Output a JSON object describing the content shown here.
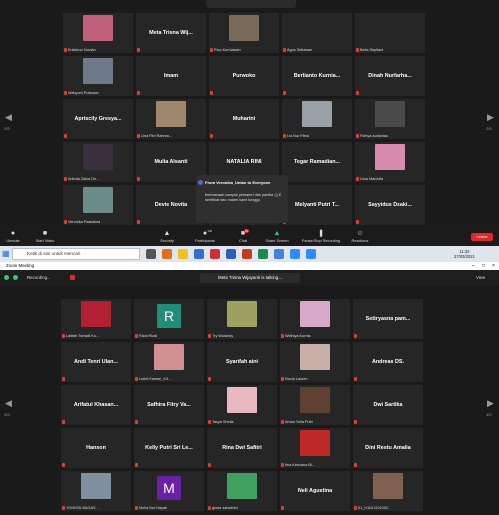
{
  "top_window": {
    "grid_rows": [
      [
        {
          "kind": "photo",
          "label": "Kristiono Novian",
          "color": "#c0607a"
        },
        {
          "kind": "name",
          "name": "Meta Trisna Wij..."
        },
        {
          "kind": "photo",
          "label": "Rico Kurniawan",
          "color": "#7a6a5a"
        },
        {
          "kind": "label",
          "label": "Agus Setiawan"
        },
        {
          "kind": "label",
          "label": "Bella Septiani"
        }
      ],
      [
        {
          "kind": "photo",
          "label": "Wahyuni Prabowo",
          "color": "#6e7a8a"
        },
        {
          "kind": "name",
          "name": "Imam"
        },
        {
          "kind": "name",
          "name": "Purwoko"
        },
        {
          "kind": "name",
          "name": "Berlianto Kurnia..."
        },
        {
          "kind": "name",
          "name": "Dinah Nurfarha..."
        }
      ],
      [
        {
          "kind": "name",
          "name": "Apriscily Gresya..."
        },
        {
          "kind": "photo",
          "label": "Lina Fitri Rahma...",
          "color": "#a0866a"
        },
        {
          "kind": "name",
          "name": "Muharini"
        },
        {
          "kind": "photo",
          "label": "Lia Nur Fitria",
          "color": "#9aa0a8"
        },
        {
          "kind": "photo",
          "label": "Fidhya Aulianisa",
          "color": "#4a4a4a"
        }
      ],
      [
        {
          "kind": "photo",
          "label": "Adinda Zakia Dri...",
          "color": "#3a3040"
        },
        {
          "kind": "name",
          "name": "Mulia Alsanti"
        },
        {
          "kind": "name",
          "name": "NATALIA RINI"
        },
        {
          "kind": "name",
          "name": "Tegar Ramadian..."
        },
        {
          "kind": "photo",
          "label": "Lisia Marchita",
          "color": "#d88ab0"
        }
      ],
      [
        {
          "kind": "photo",
          "label": "Veronika Paskalina",
          "color": "#6c8c8a"
        },
        {
          "kind": "name",
          "name": "Devie Novita"
        },
        {
          "kind": "empty"
        },
        {
          "kind": "name",
          "name": "Melyanti Putri T..."
        },
        {
          "kind": "name",
          "name": "Sayyidus Dzaki..."
        }
      ]
    ],
    "page_left": "2/5",
    "page_right": "2/5",
    "chat": {
      "from": "From Veronika_Untan to Everyone",
      "message": "terimakasih banyak pemateri dan panitia :)) E sertifikat dan materi kami tunggu"
    },
    "toolbar": {
      "unmute": "Unmute",
      "start_video": "Start Video",
      "security": "Security",
      "participants": "Participants",
      "participants_count": "106",
      "chat": "Chat",
      "chat_badge": "10",
      "share_screen": "Share Screen",
      "pause_recording": "Pause/Stop Recording",
      "reactions": "Reactions",
      "leave": "Leave"
    }
  },
  "taskbar": {
    "search_placeholder": "Ketik di sini untuk mencari",
    "time": "11:32",
    "date": "27/03/2021"
  },
  "bottom_window": {
    "title": "Zoom Meeting",
    "recording": "Recording...",
    "talking": "Meta Trisna Wijayanti is talking...",
    "view": "View",
    "page_left": "4/5",
    "page_right": "4/5",
    "grid_rows": [
      [
        {
          "kind": "photo",
          "label": "Latifah Tomaili Ku...",
          "color": "#b02030"
        },
        {
          "kind": "letter",
          "label": "Rizal Rizal",
          "letter": "R",
          "color": "#1f8f7a"
        },
        {
          "kind": "photo",
          "label": "Try Wulandy",
          "color": "#a0a060"
        },
        {
          "kind": "photo",
          "label": "Widhiya Kurnia",
          "color": "#d8a8c8"
        },
        {
          "kind": "name",
          "name": "Settryasna pam..."
        }
      ],
      [
        {
          "kind": "name",
          "name": "Andi Tenri Ulan..."
        },
        {
          "kind": "photo",
          "label": "Luthfi Kamari_K3...",
          "color": "#d09090"
        },
        {
          "kind": "name",
          "name": "Syarifah aini"
        },
        {
          "kind": "photo",
          "label": "Novia Lauren",
          "color": "#c8b0a8"
        },
        {
          "kind": "name",
          "name": "Andreas DS."
        }
      ],
      [
        {
          "kind": "name",
          "name": "Arifatul Khasan..."
        },
        {
          "kind": "name",
          "name": "Safhira Fitry Va..."
        },
        {
          "kind": "photo",
          "label": "Tasya Sheila",
          "color": "#e8b8c0"
        },
        {
          "kind": "photo",
          "label": "Amsa Yulia Putri",
          "color": "#604030"
        },
        {
          "kind": "name",
          "name": "Dwi Sartika"
        }
      ],
      [
        {
          "kind": "name",
          "name": "Hanson"
        },
        {
          "kind": "name",
          "name": "Kelly Putri Sri Le..."
        },
        {
          "kind": "name",
          "name": "Rina Dwi Safitri"
        },
        {
          "kind": "photo",
          "label": "Ima Kencana Bi...",
          "color": "#c02828"
        },
        {
          "kind": "name",
          "name": "Dini Restu Amalia"
        }
      ],
      [
        {
          "kind": "photo",
          "label": "YOHISSI BAGAS ...",
          "color": "#8090a0"
        },
        {
          "kind": "letter",
          "label": "Mulia Nur Hayati",
          "letter": "M",
          "color": "#6a1fa8"
        },
        {
          "kind": "photo",
          "label": "gloria sabathini",
          "color": "#40a060"
        },
        {
          "kind": "name",
          "name": "Neli Agustina"
        },
        {
          "kind": "photo",
          "label": "01_H1101201002...",
          "color": "#806050"
        }
      ]
    ]
  }
}
